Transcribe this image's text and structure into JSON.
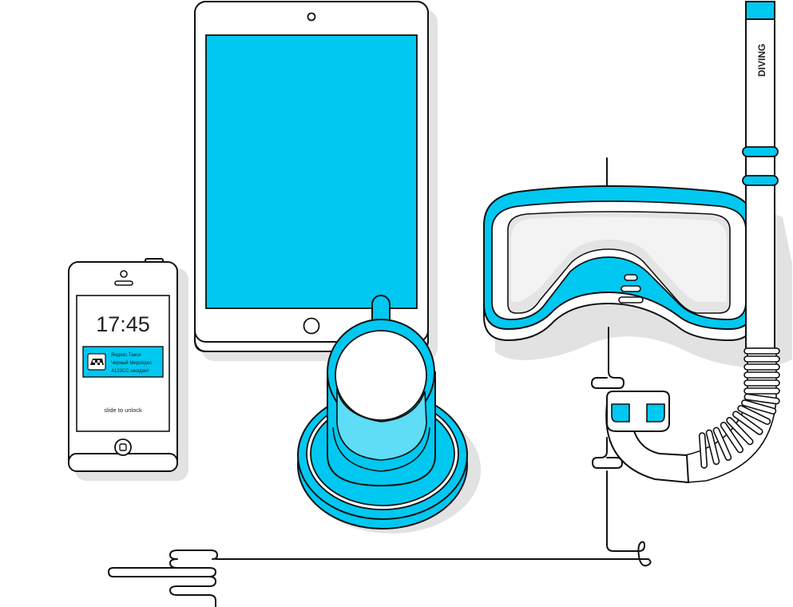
{
  "phone": {
    "time": "17:45",
    "notification": {
      "app": "Яндекс.Такси",
      "line1": "Черный Мерседес",
      "line2": "А123СС ожидает"
    },
    "unlock_hint": "slide to unlock"
  },
  "snorkel": {
    "label": "DIVING"
  },
  "colors": {
    "accent": "#00c8f0",
    "outline": "#111111",
    "shadow": "#dddddd",
    "paper": "#ffffff"
  }
}
